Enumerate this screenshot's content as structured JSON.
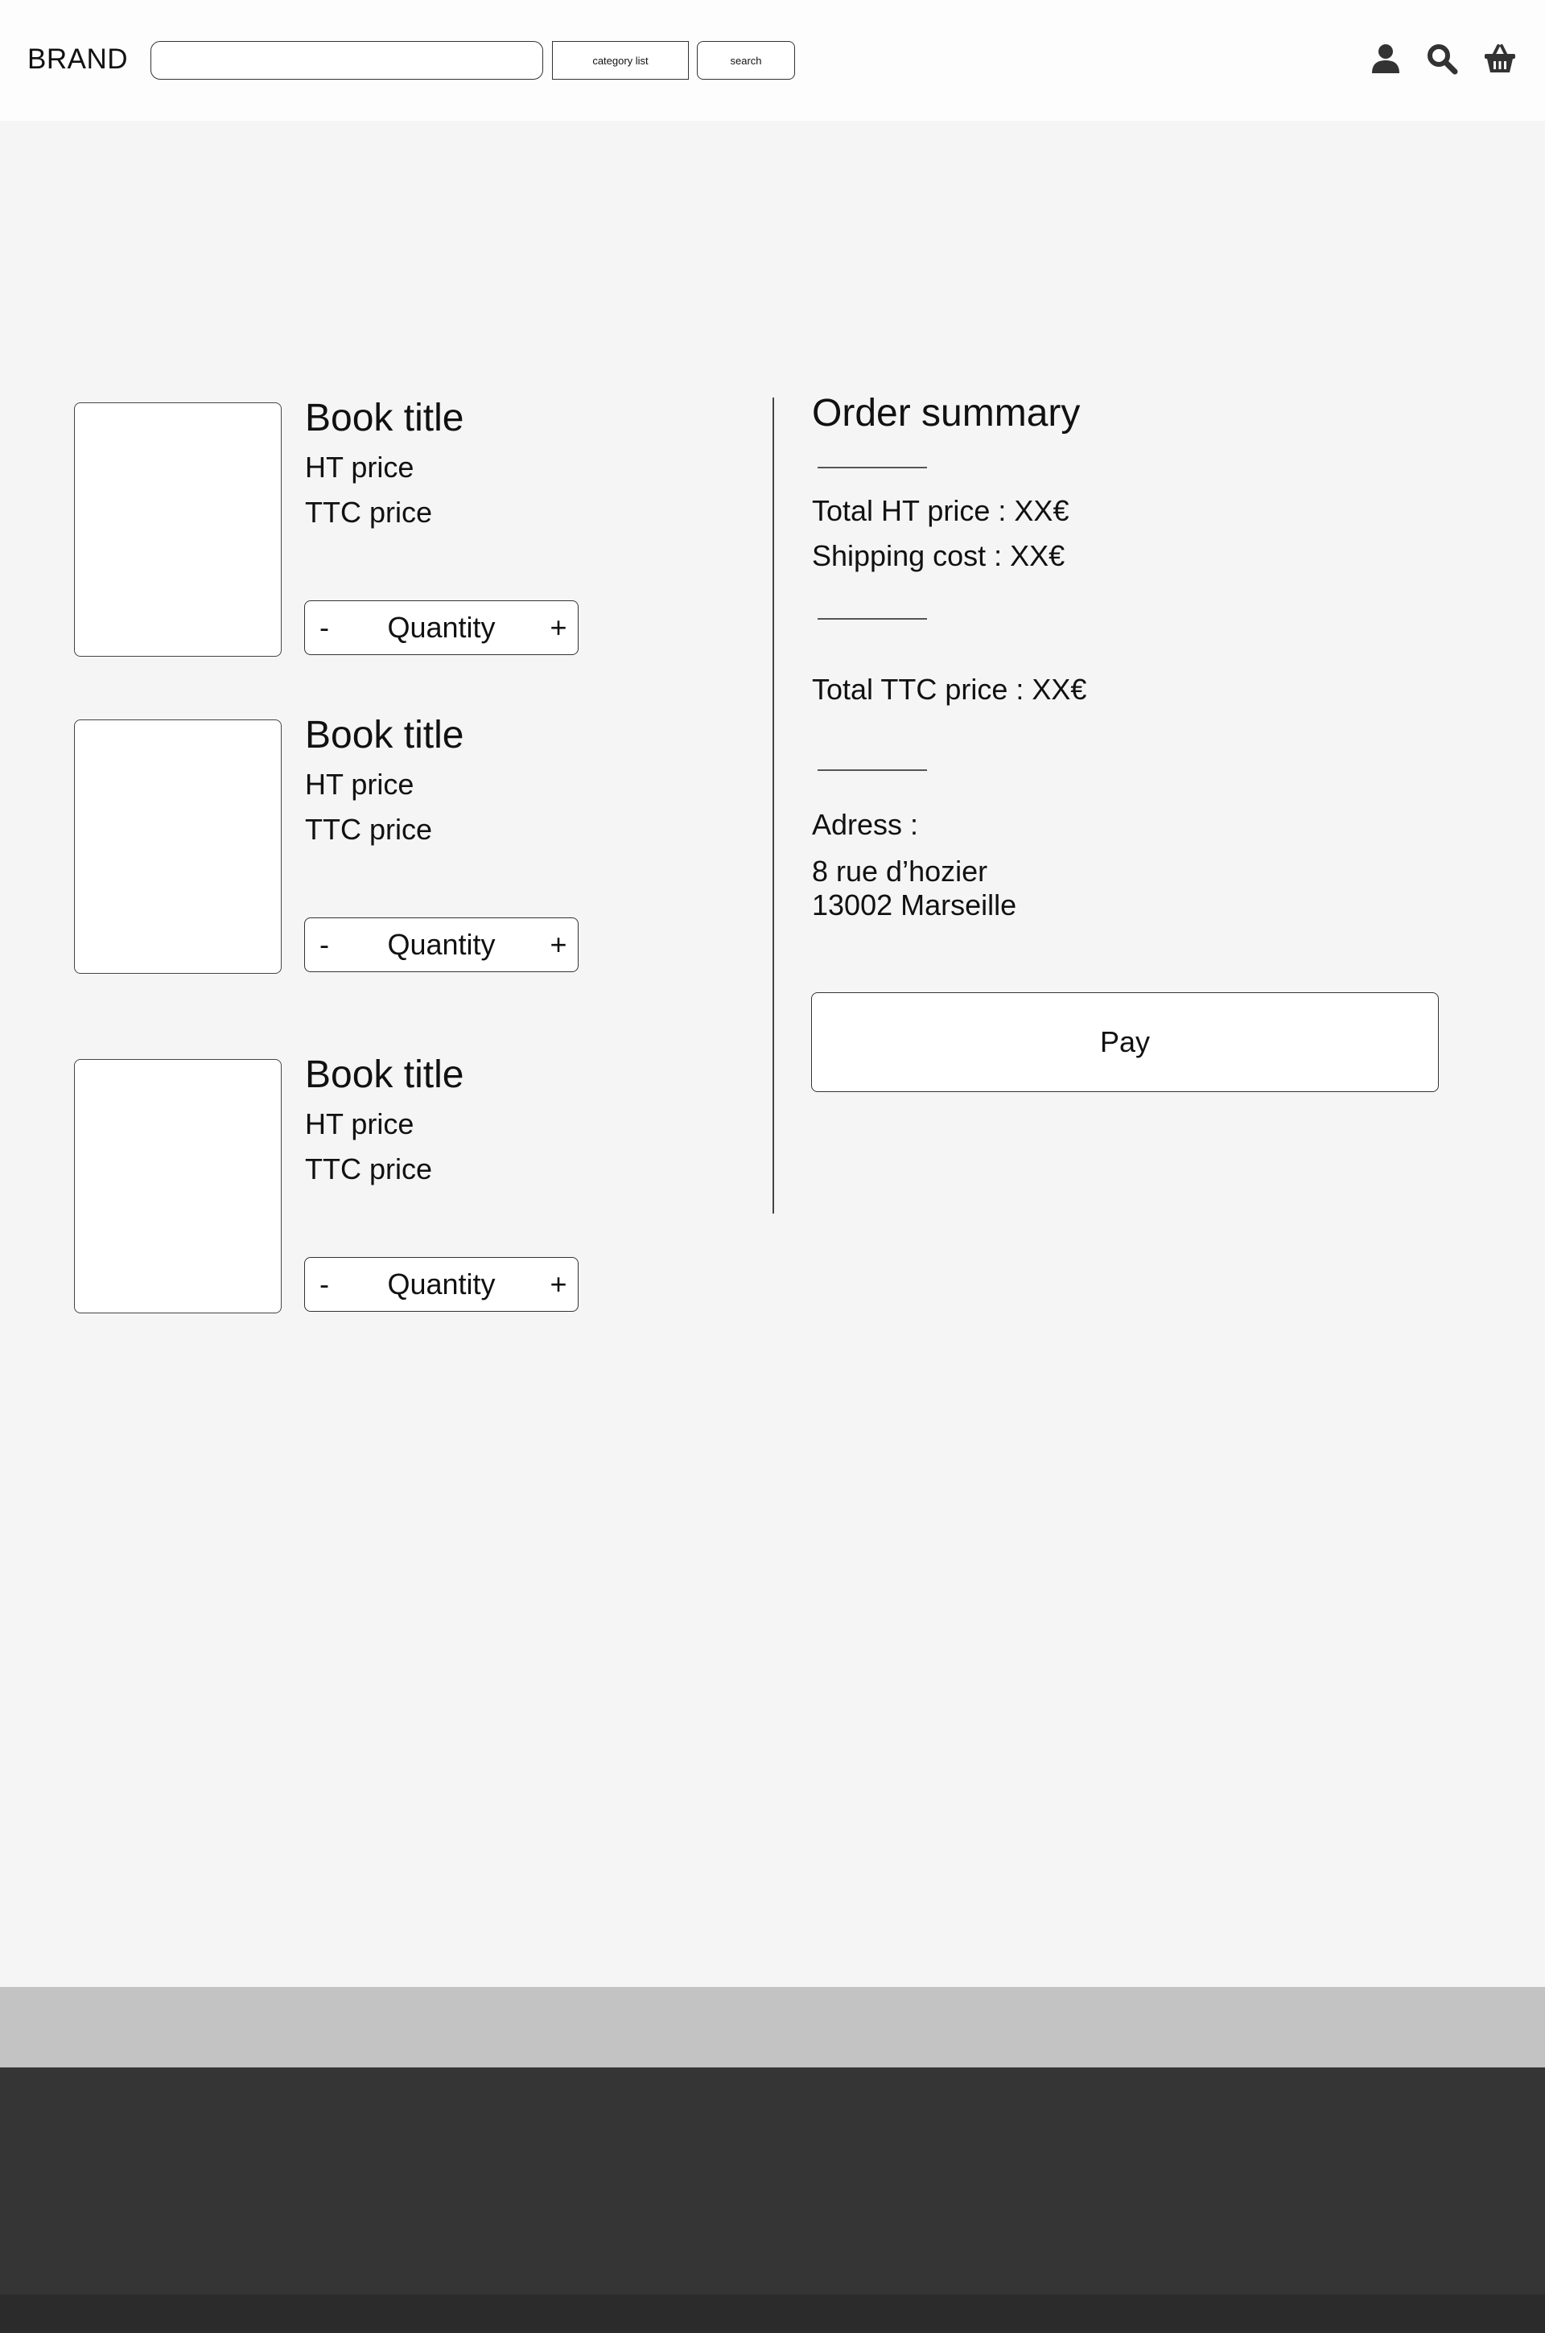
{
  "header": {
    "brand": "BRAND",
    "search_value": "",
    "search_placeholder": "",
    "category_label": "category list",
    "search_button_label": "search",
    "icons": [
      "user-icon",
      "search-icon",
      "basket-icon"
    ]
  },
  "cart": {
    "items": [
      {
        "title": "Book title",
        "ht_price": "HT price",
        "ttc_price": "TTC price",
        "minus": "-",
        "quantity": "Quantity",
        "plus": "+"
      },
      {
        "title": "Book title",
        "ht_price": "HT price",
        "ttc_price": "TTC price",
        "minus": "-",
        "quantity": "Quantity",
        "plus": "+"
      },
      {
        "title": "Book title",
        "ht_price": "HT price",
        "ttc_price": "TTC price",
        "minus": "-",
        "quantity": "Quantity",
        "plus": "+"
      }
    ]
  },
  "summary": {
    "title": "Order summary",
    "total_ht": "Total HT price : XX€",
    "shipping": "Shipping cost : XX€",
    "total_ttc": "Total TTC price : XX€",
    "address_label": "Adress :",
    "address_line1": "8 rue d’hozier",
    "address_line2": "13002 Marseille",
    "pay_label": "Pay"
  },
  "colors": {
    "page_bg": "#f5f5f5",
    "header_bg": "#fdfdfd",
    "footer_band": "#c3c3c3",
    "footer": "#353535",
    "icon": "#333333"
  }
}
